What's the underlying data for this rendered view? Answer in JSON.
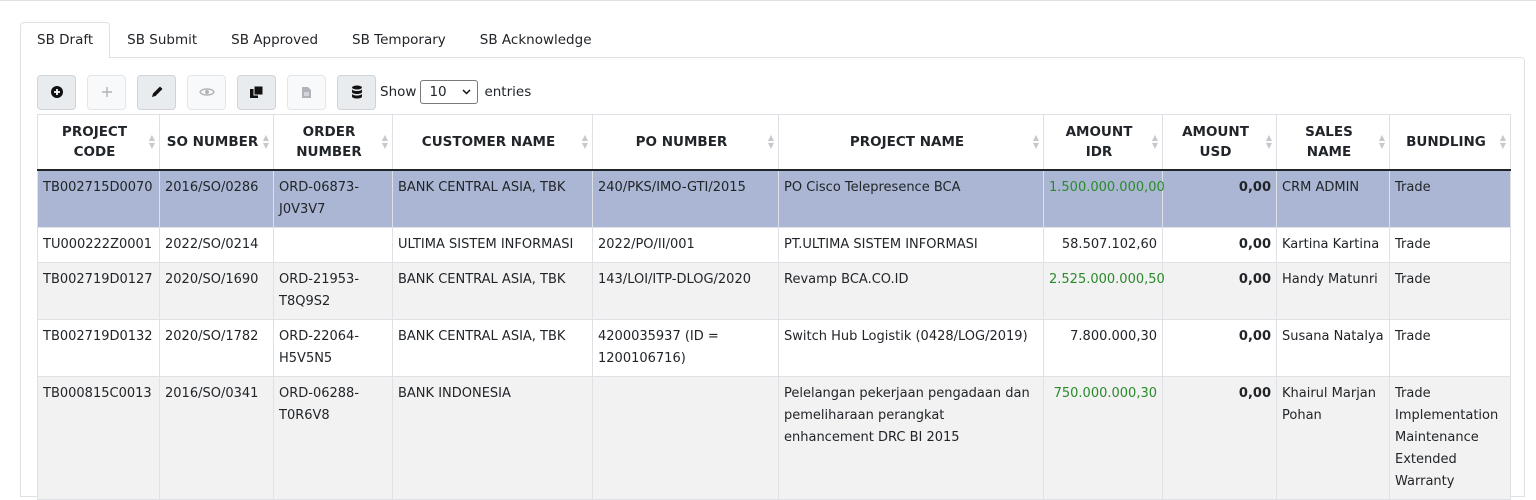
{
  "tabs": [
    {
      "label": "SB Draft",
      "active": true
    },
    {
      "label": "SB Submit"
    },
    {
      "label": "SB Approved"
    },
    {
      "label": "SB Temporary"
    },
    {
      "label": "SB Acknowledge"
    }
  ],
  "toolbar": {
    "buttons": [
      {
        "name": "add-circle",
        "icon": "plus-circle-icon",
        "enabled": true
      },
      {
        "name": "add",
        "icon": "plus-icon",
        "enabled": false
      },
      {
        "name": "edit",
        "icon": "pencil-icon",
        "enabled": true
      },
      {
        "name": "view",
        "icon": "eye-icon",
        "enabled": false
      },
      {
        "name": "copy",
        "icon": "copy-icon",
        "enabled": true
      },
      {
        "name": "document",
        "icon": "document-icon",
        "enabled": false
      },
      {
        "name": "database",
        "icon": "database-icon",
        "enabled": true
      }
    ],
    "show_label": "Show",
    "entries_value": "10",
    "entries_label": "entries"
  },
  "table": {
    "headers": [
      "PROJECT CODE",
      "SO NUMBER",
      "ORDER NUMBER",
      "CUSTOMER NAME",
      "PO NUMBER",
      "PROJECT NAME",
      "AMOUNT IDR",
      "AMOUNT USD",
      "SALES NAME",
      "BUNDLING"
    ],
    "rows": [
      {
        "selected": true,
        "cells": [
          "TB002715D0070",
          "2016/SO/0286",
          "ORD-06873-J0V3V7",
          "BANK CENTRAL ASIA, TBK",
          "240/PKS/IMO-GTI/2015",
          "PO Cisco Telepresence BCA",
          "1.500.000.000,00",
          "0,00",
          "CRM ADMIN",
          "Trade"
        ],
        "idr_green": true
      },
      {
        "cells": [
          "TU000222Z0001",
          "2022/SO/0214",
          "",
          "ULTIMA SISTEM INFORMASI",
          "2022/PO/II/001",
          "PT.ULTIMA SISTEM INFORMASI",
          "58.507.102,60",
          "0,00",
          "Kartina Kartina",
          "Trade"
        ],
        "idr_green": false
      },
      {
        "cells": [
          "TB002719D0127",
          "2020/SO/1690",
          "ORD-21953-T8Q9S2",
          "BANK CENTRAL ASIA, TBK",
          "143/LOI/ITP-DLOG/2020",
          "Revamp BCA.CO.ID",
          "2.525.000.000,50",
          "0,00",
          "Handy Matunri",
          "Trade"
        ],
        "idr_green": true
      },
      {
        "cells": [
          "TB002719D0132",
          "2020/SO/1782",
          "ORD-22064-H5V5N5",
          "BANK CENTRAL ASIA, TBK",
          "4200035937 (ID = 1200106716)",
          "Switch Hub Logistik (0428/LOG/2019)",
          "7.800.000,30",
          "0,00",
          "Susana Natalya",
          "Trade"
        ],
        "idr_green": false
      },
      {
        "cells": [
          "TB000815C0013",
          "2016/SO/0341",
          "ORD-06288-T0R6V8",
          "BANK INDONESIA",
          "",
          "Pelelangan pekerjaan pengadaan dan pemeliharaan perangkat enhancement DRC BI 2015",
          "750.000.000,30",
          "0,00",
          "Khairul Marjan Pohan",
          "Trade Implementation Maintenance Extended Warranty"
        ],
        "idr_green": true
      }
    ]
  }
}
